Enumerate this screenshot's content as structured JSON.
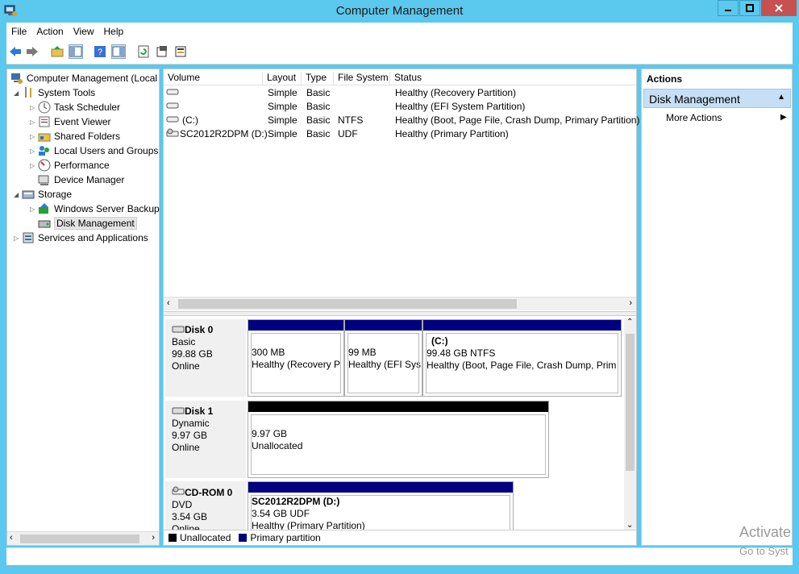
{
  "window": {
    "title": "Computer Management"
  },
  "menu": [
    "File",
    "Action",
    "View",
    "Help"
  ],
  "tree": [
    {
      "label": "Computer Management (Local",
      "icon": "computer-management-icon"
    },
    {
      "label": "System Tools",
      "icon": "tools-icon"
    },
    {
      "label": "Task Scheduler",
      "icon": "clock-icon"
    },
    {
      "label": "Event Viewer",
      "icon": "event-viewer-icon"
    },
    {
      "label": "Shared Folders",
      "icon": "shared-folder-icon"
    },
    {
      "label": "Local Users and Groups",
      "icon": "users-icon"
    },
    {
      "label": "Performance",
      "icon": "performance-icon"
    },
    {
      "label": "Device Manager",
      "icon": "device-manager-icon"
    },
    {
      "label": "Storage",
      "icon": "storage-icon"
    },
    {
      "label": "Windows Server Backup",
      "icon": "backup-icon"
    },
    {
      "label": "Disk Management",
      "icon": "disk-management-icon"
    },
    {
      "label": "Services and Applications",
      "icon": "services-icon"
    }
  ],
  "volumes": {
    "headers": [
      "Volume",
      "Layout",
      "Type",
      "File System",
      "Status"
    ],
    "rows": [
      {
        "volume": "",
        "layout": "Simple",
        "type": "Basic",
        "fs": "",
        "status": "Healthy (Recovery Partition)"
      },
      {
        "volume": "",
        "layout": "Simple",
        "type": "Basic",
        "fs": "",
        "status": "Healthy (EFI System Partition)"
      },
      {
        "volume": "(C:)",
        "layout": "Simple",
        "type": "Basic",
        "fs": "NTFS",
        "status": "Healthy (Boot, Page File, Crash Dump, Primary Partition)"
      },
      {
        "volume": "SC2012R2DPM (D:)",
        "layout": "Simple",
        "type": "Basic",
        "fs": "UDF",
        "status": "Healthy (Primary Partition)"
      }
    ]
  },
  "disks": [
    {
      "name": "Disk 0",
      "type": "Basic",
      "size": "99.88 GB",
      "state": "Online",
      "partitions": [
        {
          "title": "",
          "size": "300 MB",
          "status": "Healthy (Recovery P"
        },
        {
          "title": "",
          "size": "99 MB",
          "status": "Healthy (EFI Sys"
        },
        {
          "title": "(C:)",
          "size": "99.48 GB NTFS",
          "status": "Healthy (Boot, Page File, Crash Dump, Prim"
        }
      ]
    },
    {
      "name": "Disk 1",
      "type": "Dynamic",
      "size": "9.97 GB",
      "state": "Online",
      "partitions": [
        {
          "title": "",
          "size": "9.97 GB",
          "status": "Unallocated"
        }
      ]
    },
    {
      "name": "CD-ROM 0",
      "type": "DVD",
      "size": "3.54 GB",
      "state": "Online",
      "partitions": [
        {
          "title": "SC2012R2DPM  (D:)",
          "size": "3.54 GB UDF",
          "status": "Healthy (Primary Partition)"
        }
      ]
    }
  ],
  "legend": {
    "unallocated": "Unallocated",
    "primary": "Primary partition",
    "unallocated_color": "#000000",
    "primary_color": "#000080"
  },
  "actions": {
    "header": "Actions",
    "section": "Disk Management",
    "item": "More Actions"
  },
  "watermark": {
    "line1": "Activate",
    "line2": "Go to Syst"
  }
}
